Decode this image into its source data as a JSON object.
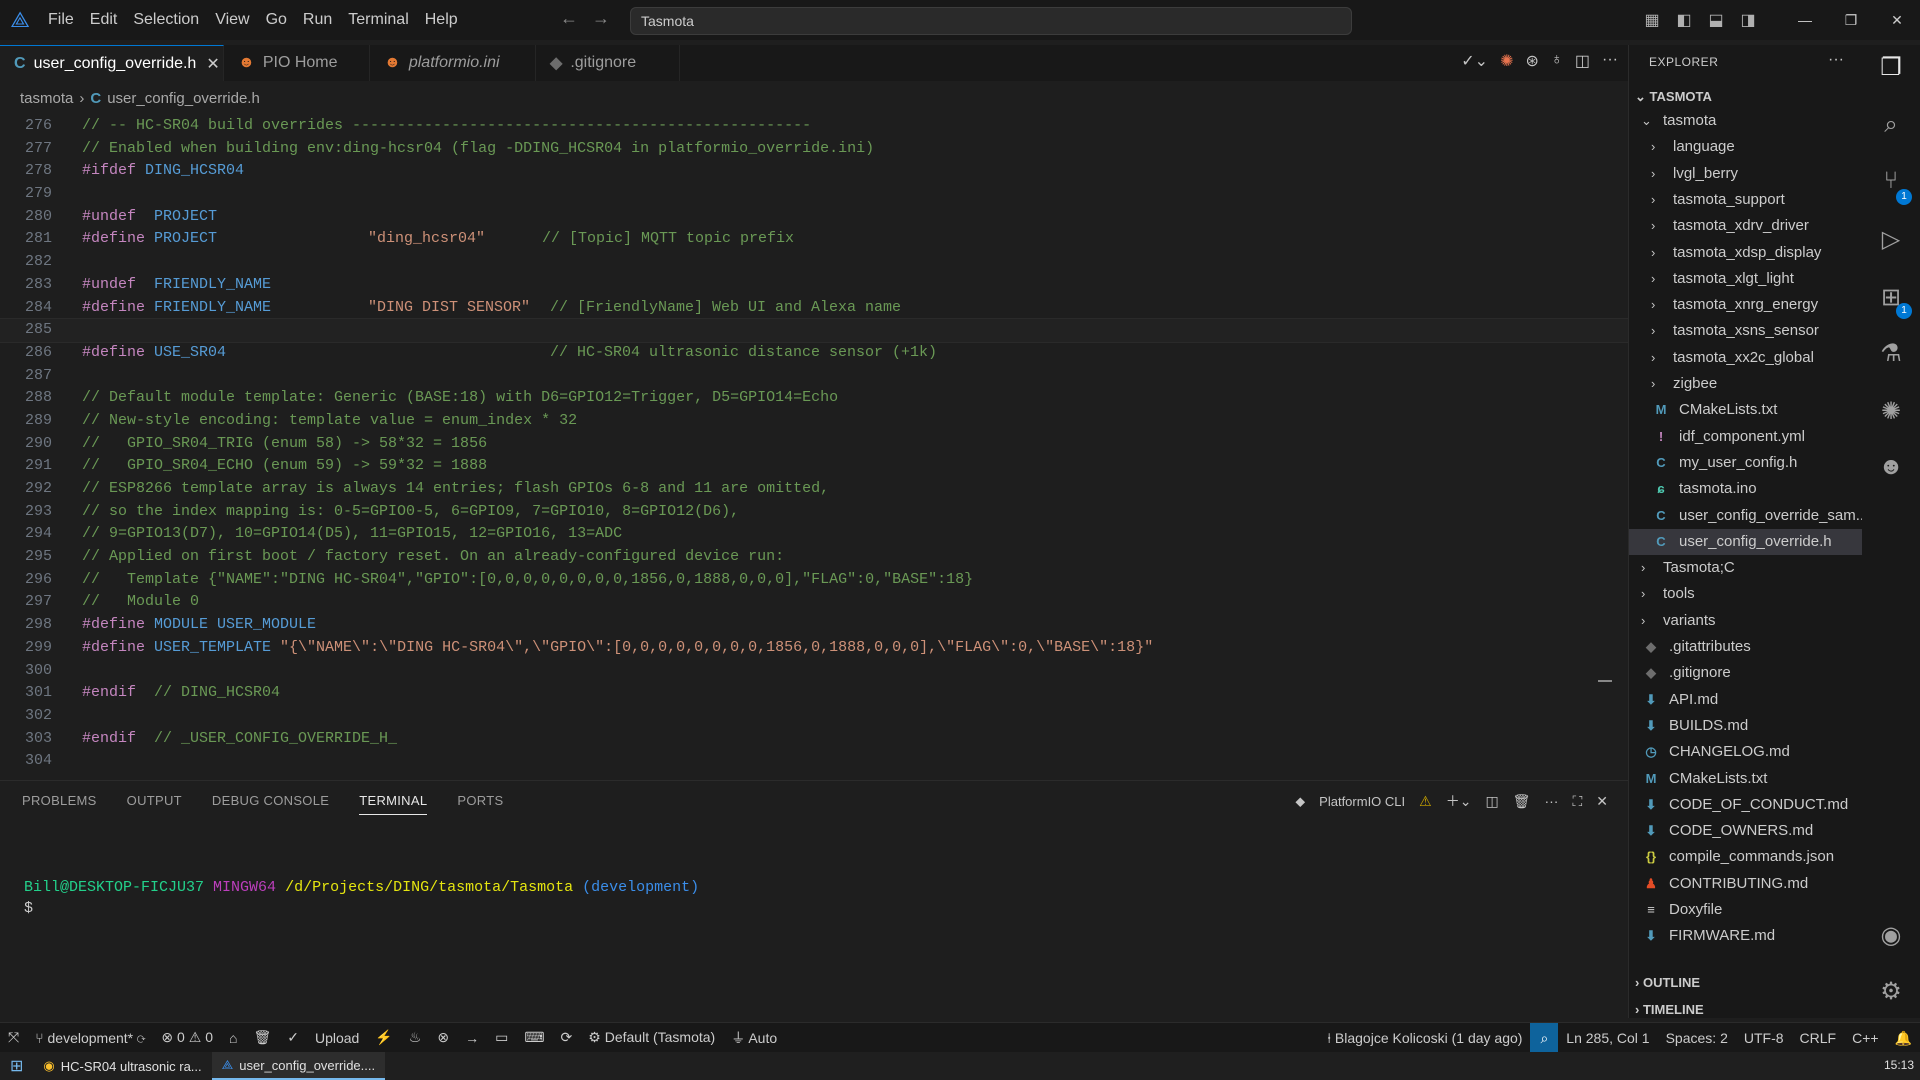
{
  "titlebar": {
    "menu": [
      "File",
      "Edit",
      "Selection",
      "View",
      "Go",
      "Run",
      "Terminal",
      "Help"
    ],
    "search_text": "Tasmota"
  },
  "tabs": [
    {
      "label": "user_config_override.h",
      "icon": "C",
      "active": true
    },
    {
      "label": "PIO Home",
      "icon": "pio-icon"
    },
    {
      "label": "platformio.ini",
      "icon": "pio-icon"
    },
    {
      "label": ".gitignore",
      "icon": "git-icon"
    }
  ],
  "breadcrumb": {
    "folder": "tasmota",
    "file_icon": "C",
    "file": "user_config_override.h"
  },
  "editor": {
    "lines": [
      {
        "n": "276",
        "t": "// -- HC-SR04 build overrides ---------------------------------------------------",
        "k": "comment"
      },
      {
        "n": "277",
        "t": "// Enabled when building env:ding-hcsr04 (flag -DDING_HCSR04 in platformio_override.ini)",
        "k": "comment"
      },
      {
        "n": "278",
        "a": "#ifdef",
        "b": " DING_HCSR04",
        "k": "pp"
      },
      {
        "n": "279",
        "t": "",
        "k": "blank"
      },
      {
        "n": "280",
        "a": "#undef",
        "b": "  PROJECT",
        "k": "pp"
      },
      {
        "n": "281",
        "a": "#define",
        "b": " PROJECT",
        "s": "\"ding_hcsr04\"",
        "c": "// [Topic] MQTT topic prefix",
        "k": "define"
      },
      {
        "n": "282",
        "t": "",
        "k": "blank"
      },
      {
        "n": "283",
        "a": "#undef",
        "b": "  FRIENDLY_NAME",
        "k": "pp"
      },
      {
        "n": "284",
        "a": "#define",
        "b": " FRIENDLY_NAME",
        "s": "\"DING DIST SENSOR\"",
        "c": "// [FriendlyName] Web UI and Alexa name",
        "k": "define"
      },
      {
        "n": "285",
        "t": "",
        "k": "current"
      },
      {
        "n": "286",
        "a": "#define",
        "b": " USE_SR04",
        "s": "",
        "c": "// HC-SR04 ultrasonic distance sensor (+1k)",
        "k": "define"
      },
      {
        "n": "287",
        "t": "",
        "k": "blank"
      },
      {
        "n": "288",
        "t": "// Default module template: Generic (BASE:18) with D6=GPIO12=Trigger, D5=GPIO14=Echo",
        "k": "comment"
      },
      {
        "n": "289",
        "t": "// New-style encoding: template value = enum_index * 32",
        "k": "comment"
      },
      {
        "n": "290",
        "t": "//   GPIO_SR04_TRIG (enum 58) -> 58*32 = 1856",
        "k": "comment"
      },
      {
        "n": "291",
        "t": "//   GPIO_SR04_ECHO (enum 59) -> 59*32 = 1888",
        "k": "comment"
      },
      {
        "n": "292",
        "t": "// ESP8266 template array is always 14 entries; flash GPIOs 6-8 and 11 are omitted,",
        "k": "comment"
      },
      {
        "n": "293",
        "t": "// so the index mapping is: 0-5=GPIO0-5, 6=GPIO9, 7=GPIO10, 8=GPIO12(D6),",
        "k": "comment"
      },
      {
        "n": "294",
        "t": "// 9=GPIO13(D7), 10=GPIO14(D5), 11=GPIO15, 12=GPIO16, 13=ADC",
        "k": "comment"
      },
      {
        "n": "295",
        "t": "// Applied on first boot / factory reset. On an already-configured device run:",
        "k": "comment"
      },
      {
        "n": "296",
        "t": "//   Template {\"NAME\":\"DING HC-SR04\",\"GPIO\":[0,0,0,0,0,0,0,0,1856,0,1888,0,0,0],\"FLAG\":0,\"BASE\":18}",
        "k": "comment"
      },
      {
        "n": "297",
        "t": "//   Module 0",
        "k": "comment"
      },
      {
        "n": "298",
        "a": "#define",
        "b": " MODULE USER_MODULE",
        "k": "pp"
      },
      {
        "n": "299",
        "a": "#define",
        "b": " USER_TEMPLATE",
        "s": " \"{\\\"NAME\\\":\\\"DING HC-SR04\\\",\\\"GPIO\\\":[0,0,0,0,0,0,0,0,1856,0,1888,0,0,0],\\\"FLAG\\\":0,\\\"BASE\\\":18}\"",
        "k": "template"
      },
      {
        "n": "300",
        "t": "",
        "k": "blank"
      },
      {
        "n": "301",
        "a": "#endif",
        "c": "  // DING_HCSR04",
        "k": "endif"
      },
      {
        "n": "302",
        "t": "",
        "k": "blank"
      },
      {
        "n": "303",
        "a": "#endif",
        "c": "  // _USER_CONFIG_OVERRIDE_H_",
        "k": "endif"
      },
      {
        "n": "304",
        "t": "",
        "k": "blank"
      }
    ]
  },
  "panel": {
    "tabs": [
      "PROBLEMS",
      "OUTPUT",
      "DEBUG CONSOLE",
      "TERMINAL",
      "PORTS"
    ],
    "active_tab": "TERMINAL",
    "terminal_name": "PlatformIO CLI",
    "prompt": {
      "user": "Bill@DESKTOP-FICJU37",
      "host": "MINGW64",
      "path": "/d/Projects/DING/tasmota/Tasmota",
      "branch": "(development)",
      "cursor": "$"
    }
  },
  "explorer": {
    "title": "EXPLORER",
    "root": "TASMOTA",
    "tree": [
      {
        "label": "tasmota",
        "type": "folder-open",
        "indent": 1
      },
      {
        "label": "language",
        "type": "folder",
        "indent": 2
      },
      {
        "label": "lvgl_berry",
        "type": "folder",
        "indent": 2
      },
      {
        "label": "tasmota_support",
        "type": "folder",
        "indent": 2
      },
      {
        "label": "tasmota_xdrv_driver",
        "type": "folder",
        "indent": 2
      },
      {
        "label": "tasmota_xdsp_display",
        "type": "folder",
        "indent": 2
      },
      {
        "label": "tasmota_xlgt_light",
        "type": "folder",
        "indent": 2
      },
      {
        "label": "tasmota_xnrg_energy",
        "type": "folder",
        "indent": 2
      },
      {
        "label": "tasmota_xsns_sensor",
        "type": "folder",
        "indent": 2
      },
      {
        "label": "tasmota_xx2c_global",
        "type": "folder",
        "indent": 2
      },
      {
        "label": "zigbee",
        "type": "folder",
        "indent": 2
      },
      {
        "label": "CMakeLists.txt",
        "type": "M",
        "indent": 2
      },
      {
        "label": "idf_component.yml",
        "type": "!",
        "indent": 2
      },
      {
        "label": "my_user_config.h",
        "type": "C",
        "indent": 2
      },
      {
        "label": "tasmota.ino",
        "type": "ino",
        "indent": 2
      },
      {
        "label": "user_config_override_sam...",
        "type": "C",
        "indent": 2
      },
      {
        "label": "user_config_override.h",
        "type": "C",
        "indent": 2,
        "selected": true
      },
      {
        "label": "Tasmota;C",
        "type": "folder",
        "indent": 1
      },
      {
        "label": "tools",
        "type": "folder",
        "indent": 1
      },
      {
        "label": "variants",
        "type": "folder",
        "indent": 1
      },
      {
        "label": ".gitattributes",
        "type": "git",
        "indent": 1
      },
      {
        "label": ".gitignore",
        "type": "git",
        "indent": 1
      },
      {
        "label": "API.md",
        "type": "md",
        "indent": 1
      },
      {
        "label": "BUILDS.md",
        "type": "md",
        "indent": 1
      },
      {
        "label": "CHANGELOG.md",
        "type": "clock",
        "indent": 1
      },
      {
        "label": "CMakeLists.txt",
        "type": "M",
        "indent": 1
      },
      {
        "label": "CODE_OF_CONDUCT.md",
        "type": "md",
        "indent": 1
      },
      {
        "label": "CODE_OWNERS.md",
        "type": "md",
        "indent": 1
      },
      {
        "label": "compile_commands.json",
        "type": "json",
        "indent": 1
      },
      {
        "label": "CONTRIBUTING.md",
        "type": "contrib",
        "indent": 1
      },
      {
        "label": "Doxyfile",
        "type": "lines",
        "indent": 1
      },
      {
        "label": "FIRMWARE.md",
        "type": "md",
        "indent": 1
      }
    ],
    "outline": "OUTLINE",
    "timeline": "TIMELINE"
  },
  "activity": {
    "scm_badge": "1",
    "ext_badge": "1"
  },
  "statusbar": {
    "branch": "development*",
    "errors": "0",
    "warnings": "0",
    "upload": "Upload",
    "env": "Default (Tasmota)",
    "auto": "Auto",
    "blame": "Blagojce Kolicoski (1 day ago)",
    "position": "Ln 285, Col 1",
    "spaces": "Spaces: 2",
    "encoding": "UTF-8",
    "eol": "CRLF",
    "language": "C++"
  },
  "taskbar": {
    "items": [
      {
        "label": "HC-SR04 ultrasonic ra..."
      },
      {
        "label": "user_config_override...."
      }
    ],
    "clock": "15:13"
  },
  "colors": {
    "accent": "#0078d4",
    "comment": "#6a9955",
    "preprocessor": "#c586c0",
    "macro": "#569cd6",
    "string": "#ce9178"
  }
}
